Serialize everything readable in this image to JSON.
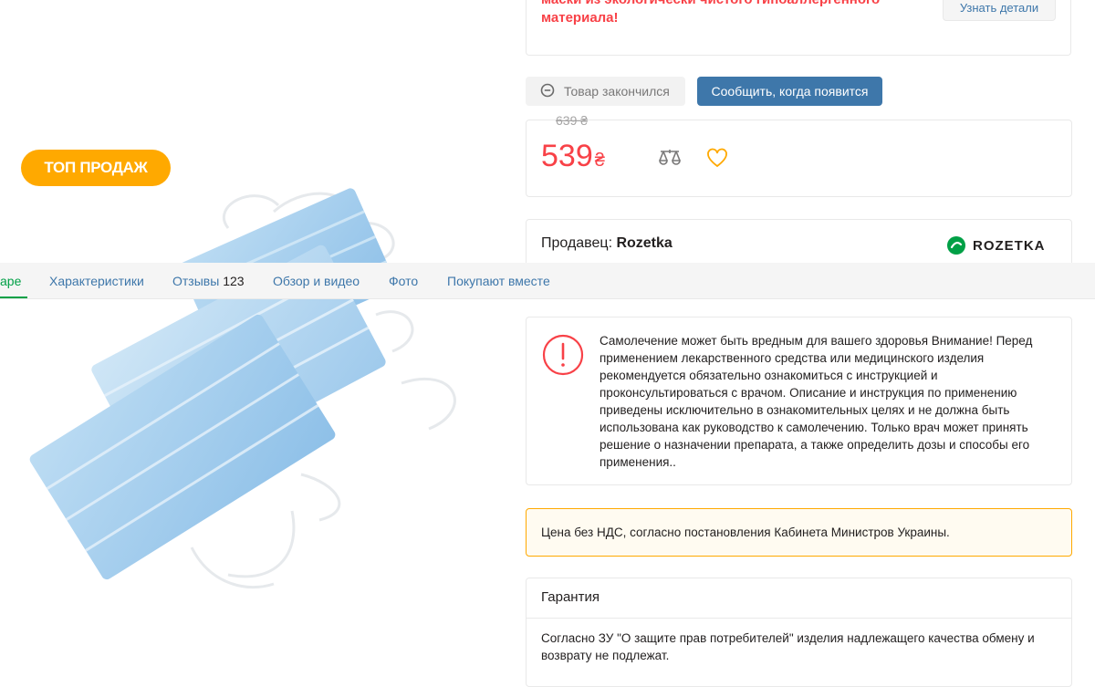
{
  "badge": {
    "label": "ТОП ПРОДАЖ"
  },
  "promo": {
    "title": "маски из экологически чистого гипоаллергенного материала!",
    "details_button": "Узнать детали"
  },
  "availability": {
    "status": "Товар закончился",
    "notify_button": "Сообщить, когда появится"
  },
  "price": {
    "old": "639 ₴",
    "current": "539",
    "currency": "₴"
  },
  "seller": {
    "label": "Продавец: ",
    "name": "Rozetka",
    "logo_text": "ROZETKA"
  },
  "tabs": [
    {
      "label": "аре"
    },
    {
      "label": "Характеристики"
    },
    {
      "label": "Отзывы",
      "count": "123"
    },
    {
      "label": "Обзор и видео"
    },
    {
      "label": "Фото"
    },
    {
      "label": "Покупают вместе"
    }
  ],
  "warning": {
    "text": "Самолечение может быть вредным для вашего здоровья Внимание! Перед применением лекарственного средства или медицинского изделия рекомендуется обязательно ознакомиться с инструкцией и проконсультироваться с врачом. Описание и инструкция по применению приведены исключительно в ознакомительных целях и не должна быть использована как руководство к самолечению. Только врач может принять решение о назначении препарата, а также определить дозы и способы его применения.."
  },
  "vat_note": "Цена без НДС, согласно постановления Кабинета Министров Украины.",
  "warranty": {
    "title": "Гарантия",
    "text": "Согласно ЗУ \"О защите прав потребителей\" изделия надлежащего качества обмену и возврату не подлежат."
  },
  "colors": {
    "accent_blue": "#3e77aa",
    "price_red": "#f84147",
    "badge_orange": "#ffa900",
    "brand_green": "#00a046"
  },
  "icons": [
    "status-minus-icon",
    "compare-icon",
    "wishlist-heart-icon",
    "rozetka-logo-icon",
    "warning-exclamation-icon"
  ]
}
